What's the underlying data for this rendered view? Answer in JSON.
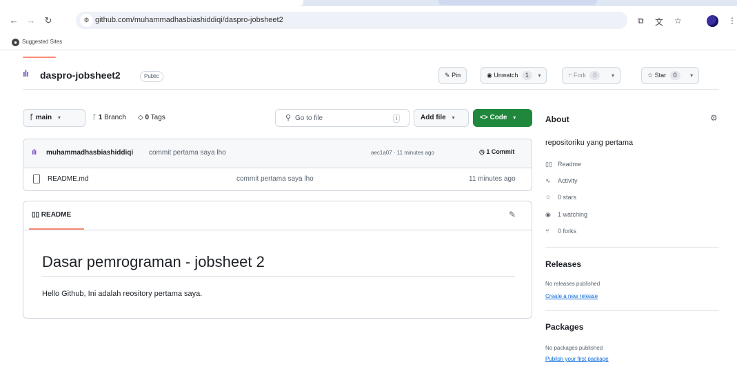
{
  "browser": {
    "url": "github.com/muhammadhasbiashiddiqi/daspro-jobsheet2",
    "bookmarks_bar": {
      "label": "Suggested Sites"
    }
  },
  "repo": {
    "name": "daspro-jobsheet2",
    "visibility": "Public",
    "pin_label": "Pin",
    "watch_label": "Unwatch",
    "watch_count": "1",
    "fork_label": "Fork",
    "fork_count": "0",
    "star_label": "Star",
    "star_count": "0"
  },
  "toolbar": {
    "branch": "main",
    "branches_count": "1",
    "branches_label": "Branch",
    "tags_count": "0",
    "tags_label": "Tags",
    "goto_placeholder": "Go to file",
    "goto_kbd": "t",
    "add_file_label": "Add file",
    "code_label": "Code"
  },
  "latest_commit": {
    "author": "muhammadhasbiashiddiqi",
    "message": "commit pertama saya lho",
    "hash_time": "aec1a07 · 11 minutes ago",
    "commit_count": "1 Commit"
  },
  "files": [
    {
      "name": "README.md",
      "message": "commit pertama saya lho",
      "time": "11 minutes ago"
    }
  ],
  "readme": {
    "tab_label": "README",
    "heading": "Dasar pemrograman - jobsheet 2",
    "body": "Hello Github, Ini adalah reository pertama saya."
  },
  "about": {
    "title": "About",
    "description": "repositoriku yang pertama",
    "readme": "Readme",
    "activity": "Activity",
    "stars": "0 stars",
    "watching": "1 watching",
    "forks": "0 forks"
  },
  "releases": {
    "title": "Releases",
    "note": "No releases published",
    "link": "Create a new release"
  },
  "packages": {
    "title": "Packages",
    "note": "No packages published",
    "link": "Publish your first package"
  }
}
